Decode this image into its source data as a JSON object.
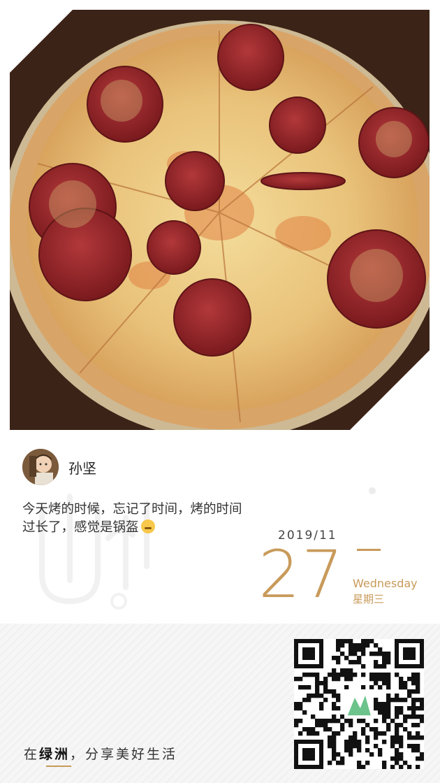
{
  "author": {
    "name": "孙坚"
  },
  "post": {
    "text": "今天烤的时候，忘记了时间，烤的时间过长了，感觉是锅盔"
  },
  "date": {
    "year_month": "2019/11",
    "day": "27",
    "weekday_en": "Wednesday",
    "weekday_cn": "星期三"
  },
  "footer": {
    "slogan_prefix": "在",
    "slogan_brand": "绿洲",
    "slogan_suffix": "，分享美好生活"
  },
  "colors": {
    "accent": "#c89a5a",
    "text": "#333333",
    "footer_bg": "#f6f6f6"
  },
  "icons": {
    "emoji": "sweat-emoji-icon",
    "qr": "qr-code-icon"
  }
}
